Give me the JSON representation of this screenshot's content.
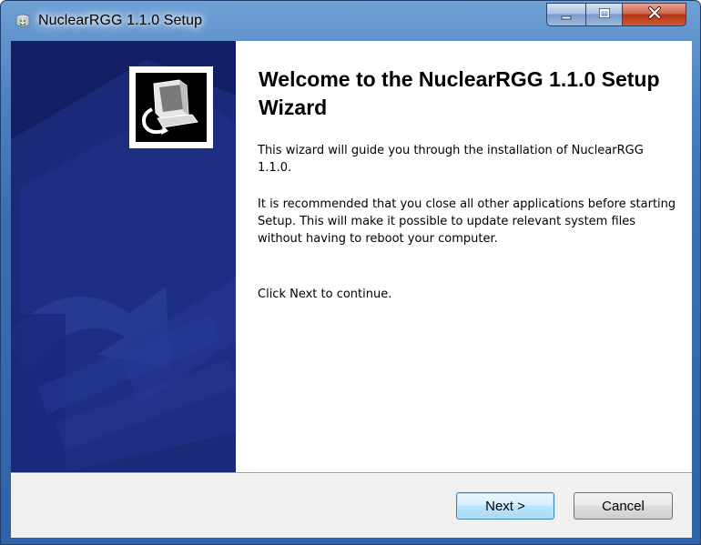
{
  "window": {
    "title": "NuclearRGG 1.1.0 Setup",
    "caption_buttons": {
      "minimize_icon": "minimize-icon",
      "maximize_icon": "maximize-icon",
      "close_icon": "close-icon"
    }
  },
  "wizard": {
    "heading": "Welcome to the NuclearRGG 1.1.0 Setup Wizard",
    "paragraphs": [
      "This wizard will guide you through the installation of NuclearRGG 1.1.0.",
      "It is recommended that you close all other applications before starting Setup. This will make it possible to update relevant system files without having to reboot your computer.",
      "Click Next to continue."
    ],
    "sidebar_logo_icon": "installer-computer-icon"
  },
  "buttons": {
    "next_label": "Next >",
    "cancel_label": "Cancel"
  },
  "colors": {
    "sidebar_background": "#141e64",
    "sidebar_accent": "#2a3a8a",
    "titlebar_blue": "#3a6fb4",
    "close_red": "#c7401f"
  }
}
